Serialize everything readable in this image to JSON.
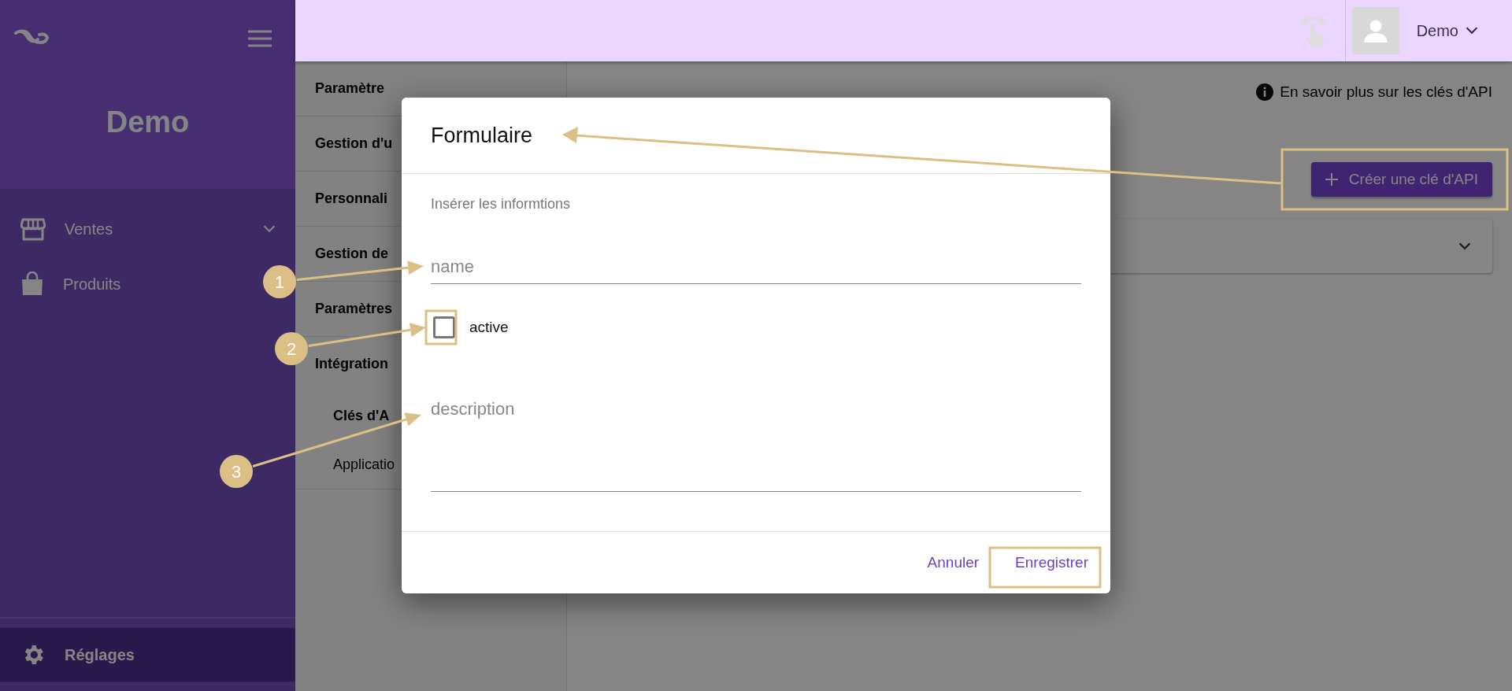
{
  "sidebar": {
    "brand": "Demo",
    "items": [
      {
        "label": "Ventes",
        "expandable": true,
        "selected": false
      },
      {
        "label": "Produits",
        "expandable": false,
        "selected": false
      }
    ],
    "footer_item": {
      "label": "Réglages",
      "selected": true
    }
  },
  "topbar": {
    "user": "Demo"
  },
  "settings_menu": {
    "items": [
      {
        "label": "Paramètre"
      },
      {
        "label": "Gestion d'u"
      },
      {
        "label": "Personnali"
      },
      {
        "label": "Gestion de"
      },
      {
        "label": "Paramètres"
      },
      {
        "label": "Intégration",
        "children": [
          {
            "label": "Clés d'A",
            "selected": true
          },
          {
            "label": "Applicatio",
            "selected": false
          }
        ]
      }
    ]
  },
  "page": {
    "help_link": "En savoir plus sur les clés d'API",
    "create_button": "Créer une clé d'API"
  },
  "dialog": {
    "title": "Formulaire",
    "subtitle": "Insérer les informtions",
    "fields": [
      {
        "kind": "text",
        "placeholder": "name"
      },
      {
        "kind": "checkbox",
        "label": "active",
        "checked": false
      },
      {
        "kind": "textarea",
        "placeholder": "description"
      }
    ],
    "actions": [
      "Annuler",
      "Enregistrer"
    ]
  },
  "annotations": [
    {
      "label": "1"
    },
    {
      "label": "2"
    },
    {
      "label": "3"
    }
  ]
}
